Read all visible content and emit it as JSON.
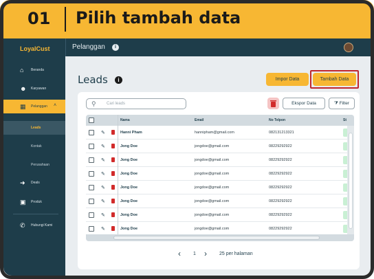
{
  "banner": {
    "step_number": "01",
    "title": "Pilih tambah data"
  },
  "app": {
    "logo": "LoyalCust",
    "page_title": "Pelanggan",
    "avatar_icon": "user-avatar"
  },
  "sidebar": {
    "items": [
      {
        "label": "Beranda",
        "icon": "home-icon"
      },
      {
        "label": "Karyawan",
        "icon": "users-icon"
      },
      {
        "label": "Pelanggan",
        "icon": "chart-icon",
        "active": true
      },
      {
        "label": "Deals",
        "icon": "deals-icon"
      },
      {
        "label": "Produk",
        "icon": "box-icon"
      },
      {
        "label": "Hubungi Kami",
        "icon": "chat-icon"
      }
    ],
    "subitems": [
      {
        "label": "Leads",
        "active": true
      },
      {
        "label": "Kontak"
      },
      {
        "label": "Perusahaan"
      }
    ]
  },
  "main": {
    "title": "Leads",
    "buttons": {
      "import": "Impor Data",
      "add": "Tambah Data",
      "export": "Ekspor Data",
      "filter": "Filter"
    },
    "search_placeholder": "Cari leads"
  },
  "table": {
    "columns": [
      "Nama",
      "Email",
      "No Telpon",
      "St"
    ],
    "rows": [
      {
        "name": "Hanni Pham",
        "email": "hannipham@gmail.com",
        "phone": "082131213321"
      },
      {
        "name": "Jong Doe",
        "email": "jongdoe@gmail.com",
        "phone": "08229292922"
      },
      {
        "name": "Jong Doe",
        "email": "jongdoe@gmail.com",
        "phone": "08229292922"
      },
      {
        "name": "Jong Doe",
        "email": "jongdoe@gmail.com",
        "phone": "08229292922"
      },
      {
        "name": "Jong Doe",
        "email": "jongdoe@gmail.com",
        "phone": "08229292922"
      },
      {
        "name": "Jong Doe",
        "email": "jongdoe@gmail.com",
        "phone": "08229292922"
      },
      {
        "name": "Jong Doe",
        "email": "jongdoe@gmail.com",
        "phone": "08229292922"
      },
      {
        "name": "Jong Doe",
        "email": "jongdoe@gmail.com",
        "phone": "08229292922"
      }
    ]
  },
  "pagination": {
    "page": "1",
    "per_page": "25 per halaman"
  },
  "colors": {
    "accent": "#f7b733",
    "sidebar": "#1e3d4a",
    "highlight": "#c0262d",
    "danger": "#d12b2b"
  }
}
